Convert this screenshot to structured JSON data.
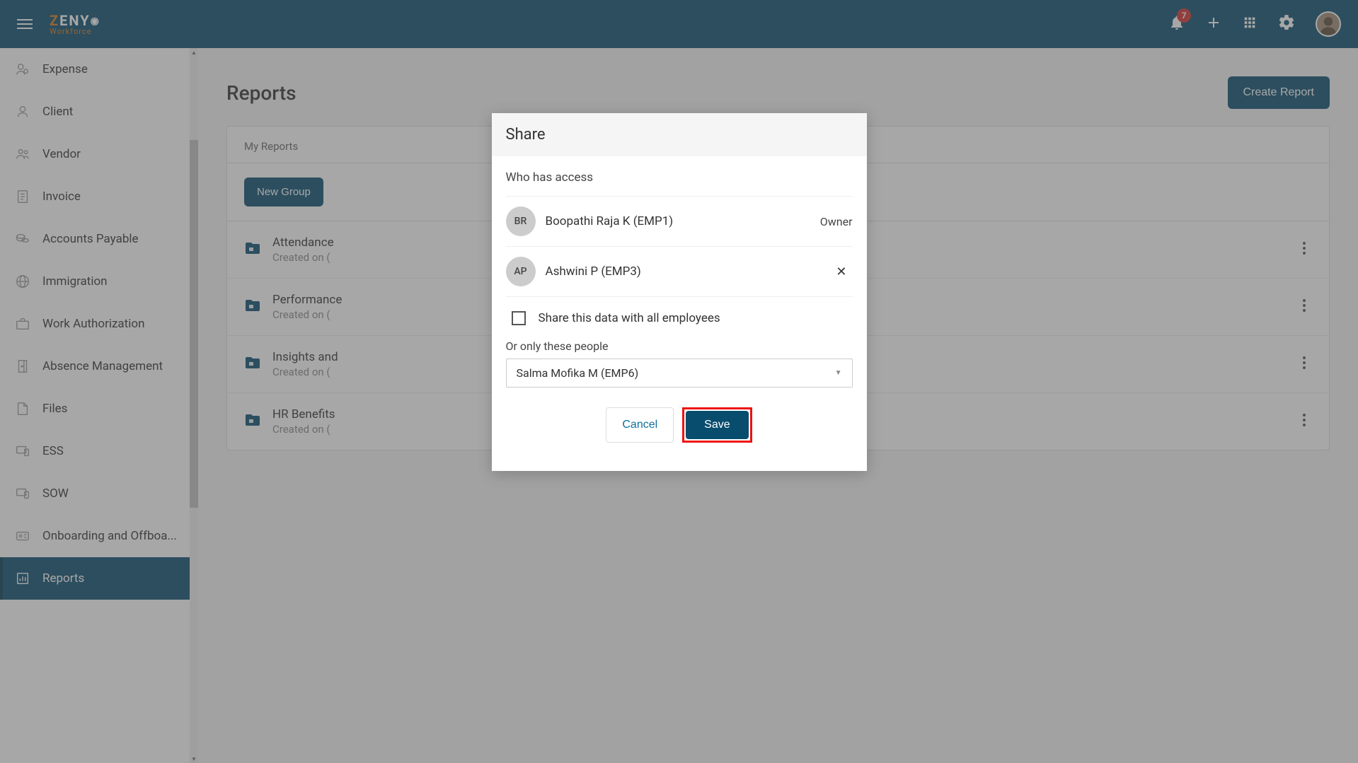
{
  "header": {
    "logo_top_z": "Z",
    "logo_top_rest": "ENY",
    "logo_bottom": "Workforce",
    "notification_count": "7"
  },
  "sidebar": {
    "items": [
      {
        "label": "Expense",
        "icon": "expense-icon",
        "active": false
      },
      {
        "label": "Client",
        "icon": "person-icon",
        "active": false
      },
      {
        "label": "Vendor",
        "icon": "people-icon",
        "active": false
      },
      {
        "label": "Invoice",
        "icon": "invoice-icon",
        "active": false
      },
      {
        "label": "Accounts Payable",
        "icon": "coins-icon",
        "active": false
      },
      {
        "label": "Immigration",
        "icon": "globe-icon",
        "active": false
      },
      {
        "label": "Work Authorization",
        "icon": "briefcase-icon",
        "active": false
      },
      {
        "label": "Absence Management",
        "icon": "door-icon",
        "active": false
      },
      {
        "label": "Files",
        "icon": "file-icon",
        "active": false
      },
      {
        "label": "ESS",
        "icon": "device-icon",
        "active": false
      },
      {
        "label": "SOW",
        "icon": "device-icon",
        "active": false
      },
      {
        "label": "Onboarding and Offboa...",
        "icon": "card-icon",
        "active": false
      },
      {
        "label": "Reports",
        "icon": "chart-icon",
        "active": true
      }
    ]
  },
  "content": {
    "title": "Reports",
    "create_label": "Create Report",
    "tab_label": "My Reports",
    "new_group_label": "New Group",
    "reports": [
      {
        "name": "Attendance",
        "date": "Created on ("
      },
      {
        "name": "Performance",
        "date": "Created on ("
      },
      {
        "name": "Insights and",
        "date": "Created on ("
      },
      {
        "name": "HR Benefits",
        "date": "Created on ("
      }
    ]
  },
  "modal": {
    "title": "Share",
    "access_label": "Who has access",
    "owner_role": "Owner",
    "users": [
      {
        "initials": "BR",
        "name": "Boopathi Raja K (EMP1)",
        "owner": true
      },
      {
        "initials": "AP",
        "name": "Ashwini P (EMP3)",
        "owner": false
      }
    ],
    "share_all_label": "Share this data with all employees",
    "only_label": "Or only these people",
    "selected_person": "Salma Mofika M (EMP6)",
    "cancel_label": "Cancel",
    "save_label": "Save"
  }
}
